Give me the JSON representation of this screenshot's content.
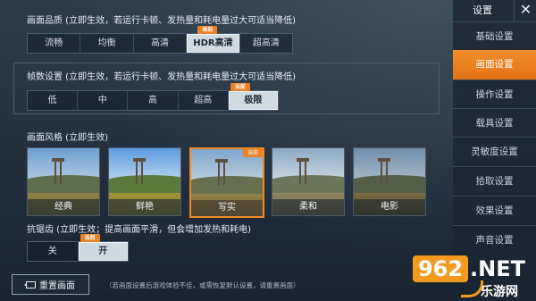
{
  "graphics_quality": {
    "title": "画面品质 (立即生效，若运行卡顿、发热量和耗电量过大可适当降低)",
    "options": [
      "流畅",
      "均衡",
      "高清",
      "HDR高清",
      "超高清"
    ],
    "selected": "HDR高清",
    "current_tag": "当前"
  },
  "frame_rate": {
    "title": "帧数设置 (立即生效，若运行卡顿、发热量和耗电量过大可适当降低)",
    "options": [
      "低",
      "中",
      "高",
      "超高",
      "极限"
    ],
    "selected": "极限",
    "current_tag": "当前"
  },
  "style": {
    "title": "画面风格 (立即生效)",
    "options": [
      "经典",
      "鲜艳",
      "写实",
      "柔和",
      "电影"
    ],
    "selected": "写实",
    "current_tag": "当前"
  },
  "antialiasing": {
    "title": "抗锯齿 (立即生效；提高画面平滑，但会增加发热和耗电)",
    "options": [
      "关",
      "开"
    ],
    "selected": "开",
    "current_tag": "当前"
  },
  "reset_button": "重置画面",
  "footer_note": "（若画面设置后游戏体验不佳，或需恢复默认设置，请重置画面）",
  "sidebar": {
    "title": "设置",
    "items": [
      "基础设置",
      "画面设置",
      "操作设置",
      "载具设置",
      "灵敏度设置",
      "拾取设置",
      "效果设置",
      "声音设置"
    ],
    "active": "画面设置"
  },
  "watermark": {
    "number": "962",
    "suffix": ".NET",
    "sub": "乐游网"
  },
  "colors": {
    "accent": "#f28c2a",
    "tag": "#e8832a"
  }
}
